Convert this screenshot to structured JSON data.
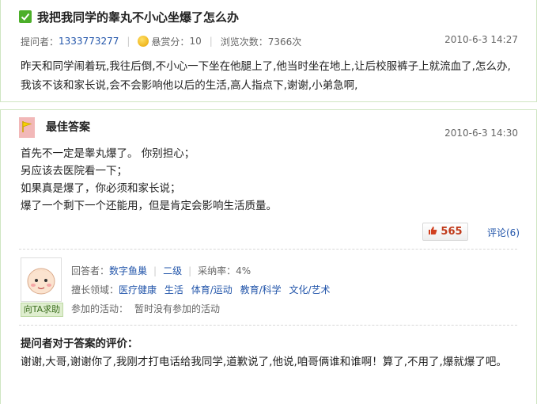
{
  "question": {
    "title": "我把我同学的睾丸不小心坐爆了怎么办",
    "asker_label": "提问者：",
    "asker": "1333773277",
    "bounty_label": "悬赏分：",
    "bounty": "10",
    "views": "浏览次数：7366次",
    "date": "2010-6-3 14:27",
    "body": "昨天和同学闹着玩,我往后倒,不小心一下坐在他腿上了,他当时坐在地上,让后校服裤子上就流血了,怎么办,我该不该和家长说,会不会影响他以后的生活,高人指点下,谢谢,小弟急啊,"
  },
  "best_answer": {
    "title": "最佳答案",
    "date": "2010-6-3 14:30",
    "lines": [
      "首先不一定是睾丸爆了。 你别担心；",
      "另应该去医院看一下；",
      "如果真是爆了，你必须和家长说；",
      "爆了一个剩下一个还能用，但是肯定会影响生活质量。"
    ],
    "likes": "565",
    "comments": "评论(6)"
  },
  "answerer": {
    "label": "回答者：",
    "name": "数字鱼巢",
    "level": "二级",
    "adopt_rate": "采纳率：4%",
    "fields_label": "擅长领域：",
    "fields": [
      "医疗健康",
      "生活",
      "体育/运动",
      "教育/科学",
      "文化/艺术"
    ],
    "activity_label": "参加的活动：",
    "activity": "暂时没有参加的活动",
    "help_button": "向TA求助"
  },
  "evaluation": {
    "title": "提问者对于答案的评价：",
    "body": "谢谢,大哥,谢谢你了,我刚才打电话给我同学,道歉说了,他说,咱哥俩谁和谁啊！算了,不用了,爆就爆了吧。"
  },
  "colors": {
    "link": "#2255aa",
    "panel_border": "#cfe6c2",
    "check": "#4caf2a",
    "like_count": "#c03a1a"
  }
}
